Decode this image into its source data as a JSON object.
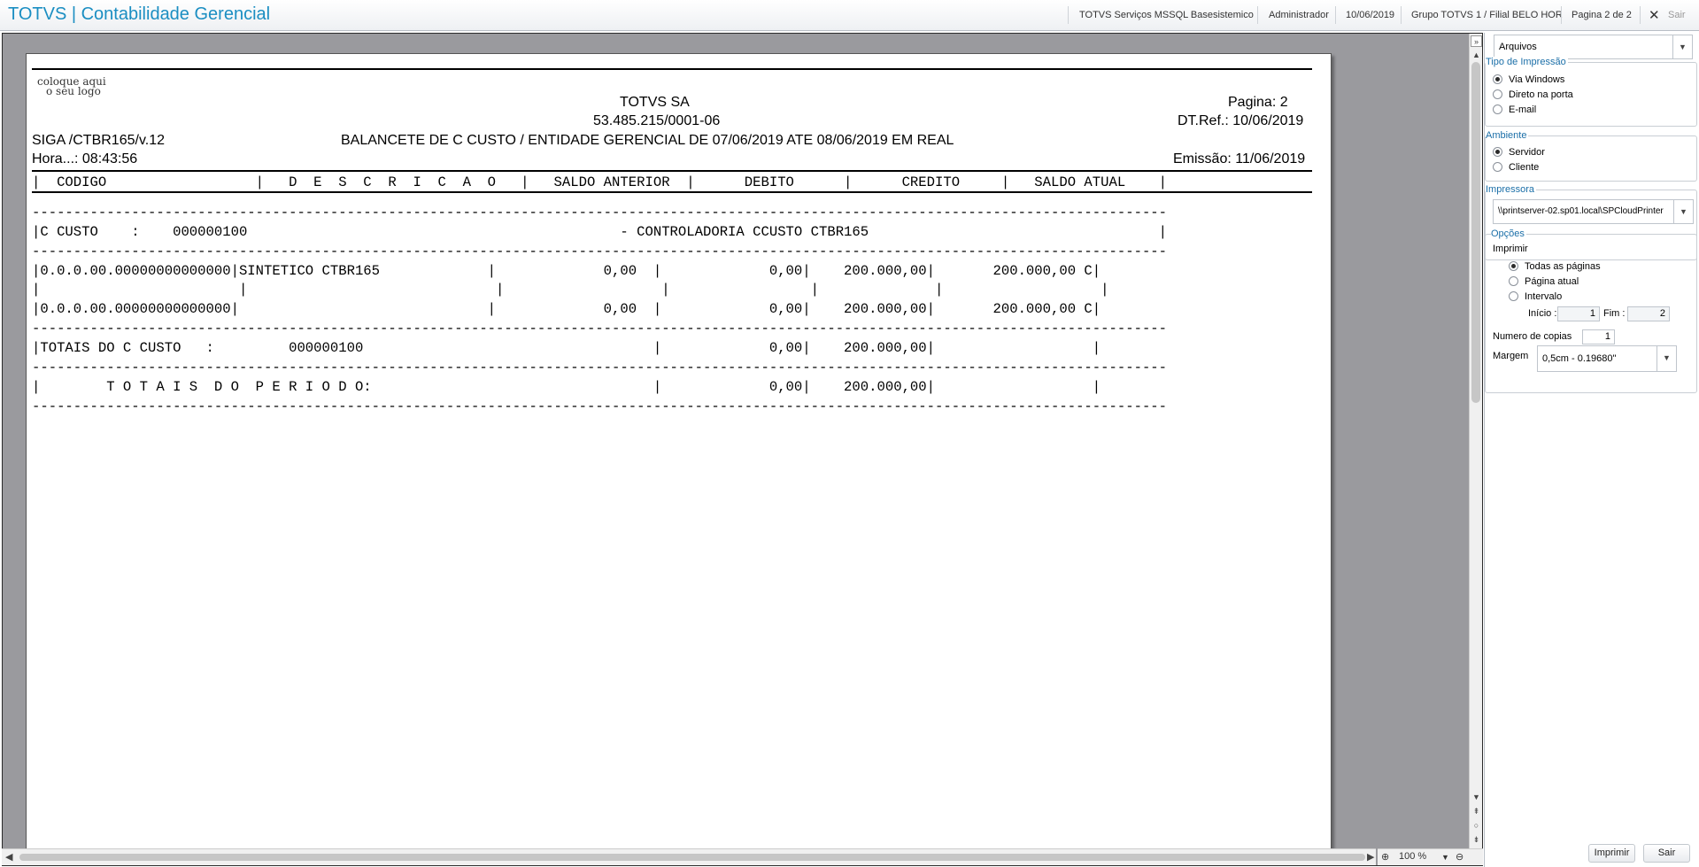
{
  "header": {
    "title": "TOTVS | Contabilidade Gerencial",
    "environment": "TOTVS Serviços MSSQL Basesistemico",
    "user": "Administrador",
    "date": "10/06/2019",
    "branch": "Grupo TOTVS 1 / Filial BELO HOR",
    "page": "Pagina 2 de 2",
    "exit_label": "Sair",
    "close_icon": "close-icon"
  },
  "report": {
    "logo_line1": "coloque aqui",
    "logo_line2": "o seu logo",
    "company": "TOTVS SA",
    "cnpj": "53.485.215/0001-06",
    "page_label": "Pagina:     2",
    "dtref": "DT.Ref.: 10/06/2019",
    "program": "SIGA /CTBR165/v.12",
    "report_title": "BALANCETE DE C CUSTO    /  ENTIDADE GERENCIAL  DE 07/06/2019 ATE 08/06/2019  EM REAL",
    "time": "Hora...: 08:43:56",
    "emission": "Emissão: 11/06/2019",
    "columns_line": "|  CODIGO                  |   D  E  S  C  R  I  C  A  O   |   SALDO ANTERIOR  |      DEBITO      |      CREDITO     |   SALDO ATUAL    |",
    "dash_line": "-----------------------------------------------------------------------------------------------------------------------------------------",
    "cost_center_line": "|C CUSTO    :    000000100                                             - CONTROLADORIA CCUSTO CTBR165                                   |",
    "row1": "|0.0.0.00.00000000000000|SINTETICO CTBR165             |             0,00  |             0,00|    200.000,00|       200.000,00 C|",
    "row_blank": "|                        |                              |                   |                 |              |                   |",
    "row2": "|0.0.0.00.00000000000000|                              |             0,00  |             0,00|    200.000,00|       200.000,00 C|",
    "totals_cc": "|TOTAIS DO C CUSTO   :         000000100                                   |             0,00|    200.000,00|                   |",
    "totals_period": "|        T O T A I S  D O  P E R I O D O:                                  |             0,00|    200.000,00|                   |"
  },
  "zoom": {
    "value": "100 %",
    "zoom_in_icon": "zoom-in-icon",
    "zoom_out_icon": "zoom-out-icon"
  },
  "panel": {
    "output": "Arquivos",
    "print_type_label": "Tipo de Impressão",
    "print_type_options": [
      "Via Windows",
      "Direto na porta",
      "E-mail"
    ],
    "environment_label": "Ambiente",
    "environment_options": [
      "Servidor",
      "Cliente"
    ],
    "printer_label": "Impressora",
    "printer_value": "\\\\printserver-02.sp01.local\\SPCloudPrinter",
    "options_label": "Opções",
    "print_label": "Imprimir",
    "print_options": [
      "Todas as páginas",
      "Página atual",
      "Intervalo"
    ],
    "start_label": "Início :",
    "start_value": "1",
    "end_label": "Fim :",
    "end_value": "2",
    "copies_label": "Numero de copias",
    "copies_value": "1",
    "margin_label": "Margem",
    "margin_value": "0,5cm - 0.19680\"",
    "print_button": "Imprimir",
    "exit_button": "Sair"
  }
}
